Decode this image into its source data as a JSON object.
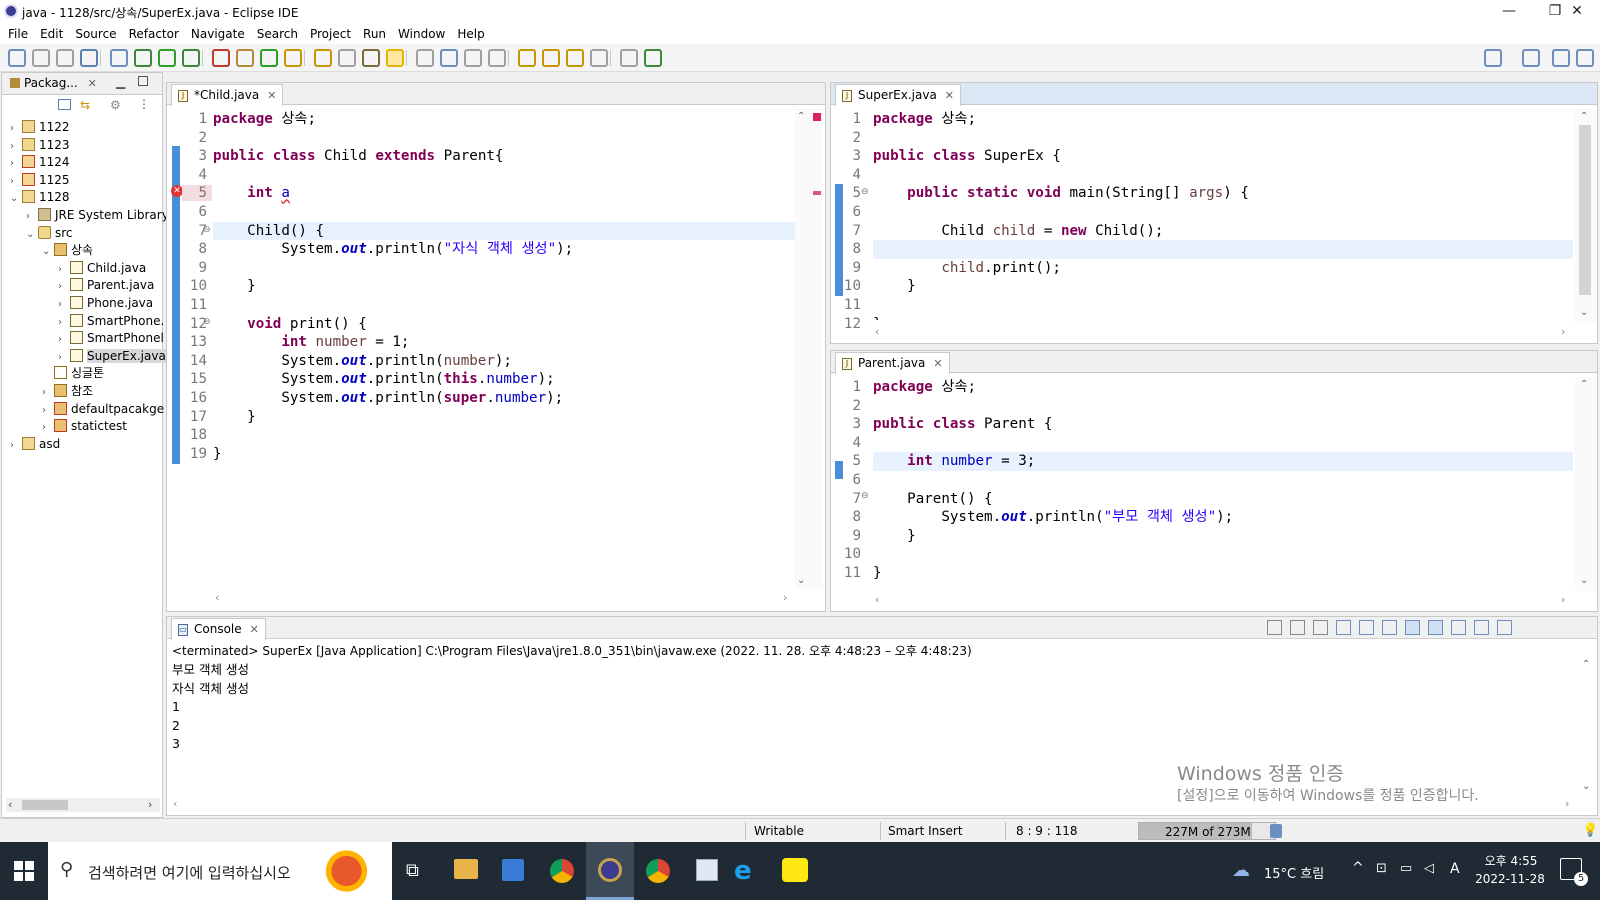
{
  "window": {
    "title": "java - 1128/src/상속/SuperEx.java - Eclipse IDE",
    "min": "—",
    "max": "❐",
    "close": "✕"
  },
  "menu": [
    "File",
    "Edit",
    "Source",
    "Refactor",
    "Navigate",
    "Search",
    "Project",
    "Run",
    "Window",
    "Help"
  ],
  "package_explorer": {
    "title": "Packag...",
    "items": [
      {
        "label": "1122",
        "indent": 0,
        "arrow": "›",
        "type": "project"
      },
      {
        "label": "1123",
        "indent": 0,
        "arrow": "›",
        "type": "project"
      },
      {
        "label": "1124",
        "indent": 0,
        "arrow": "›",
        "type": "project-err"
      },
      {
        "label": "1125",
        "indent": 0,
        "arrow": "›",
        "type": "project-err"
      },
      {
        "label": "1128",
        "indent": 0,
        "arrow": "⌄",
        "type": "project"
      },
      {
        "label": "JRE System Library",
        "indent": 1,
        "arrow": "›",
        "type": "lib"
      },
      {
        "label": "src",
        "indent": 1,
        "arrow": "⌄",
        "type": "src"
      },
      {
        "label": "상속",
        "indent": 2,
        "arrow": "⌄",
        "type": "pkg"
      },
      {
        "label": "Child.java",
        "indent": 3,
        "arrow": "›",
        "type": "java"
      },
      {
        "label": "Parent.java",
        "indent": 3,
        "arrow": "›",
        "type": "java"
      },
      {
        "label": "Phone.java",
        "indent": 3,
        "arrow": "›",
        "type": "java"
      },
      {
        "label": "SmartPhone.",
        "indent": 3,
        "arrow": "›",
        "type": "java"
      },
      {
        "label": "SmartPhonel",
        "indent": 3,
        "arrow": "›",
        "type": "java"
      },
      {
        "label": "SuperEx.java",
        "indent": 3,
        "arrow": "›",
        "type": "java-selected"
      },
      {
        "label": "싱글톤",
        "indent": 2,
        "arrow": "",
        "type": "pkg-empty"
      },
      {
        "label": "참조",
        "indent": 2,
        "arrow": "›",
        "type": "pkg"
      },
      {
        "label": "defaultpacakge",
        "indent": 2,
        "arrow": "›",
        "type": "pkg-err"
      },
      {
        "label": "statictest",
        "indent": 2,
        "arrow": "›",
        "type": "pkg-err"
      },
      {
        "label": "asd",
        "indent": 0,
        "arrow": "›",
        "type": "project"
      }
    ]
  },
  "editors": {
    "child": {
      "tab": "*Child.java",
      "numbers": [
        "1",
        "2",
        "3",
        "4",
        "5",
        "6",
        "7",
        "8",
        "9",
        "10",
        "11",
        "12",
        "13",
        "14",
        "15",
        "16",
        "17",
        "18",
        "19"
      ]
    },
    "superex": {
      "tab": "SuperEx.java",
      "numbers": [
        "1",
        "2",
        "3",
        "4",
        "5",
        "6",
        "7",
        "8",
        "9",
        "10",
        "11",
        "12"
      ]
    },
    "parent": {
      "tab": "Parent.java",
      "numbers": [
        "1",
        "2",
        "3",
        "4",
        "5",
        "6",
        "7",
        "8",
        "9",
        "10",
        "11"
      ]
    }
  },
  "console": {
    "tab": "Console",
    "header": "<terminated> SuperEx [Java Application] C:\\Program Files\\Java\\jre1.8.0_351\\bin\\javaw.exe  (2022. 11. 28. 오후 4:48:23 – 오후 4:48:23)",
    "output": [
      "부모 객체 생성",
      "자식 객체 생성",
      "1",
      "2",
      "3"
    ],
    "watermark_title": "Windows 정품 인증",
    "watermark_sub": "[설정]으로 이동하여 Windows를 정품 인증합니다."
  },
  "status": {
    "writable": "Writable",
    "insert": "Smart Insert",
    "position": "8 : 9 : 118",
    "heap": "227M of 273M",
    "heap_fraction": 0.83
  },
  "taskbar": {
    "search_placeholder": "검색하려면 여기에 입력하십시오",
    "weather": "15°C 흐림",
    "ime": "A",
    "time": "오후 4:55",
    "date": "2022-11-28",
    "notif_count": "5"
  }
}
